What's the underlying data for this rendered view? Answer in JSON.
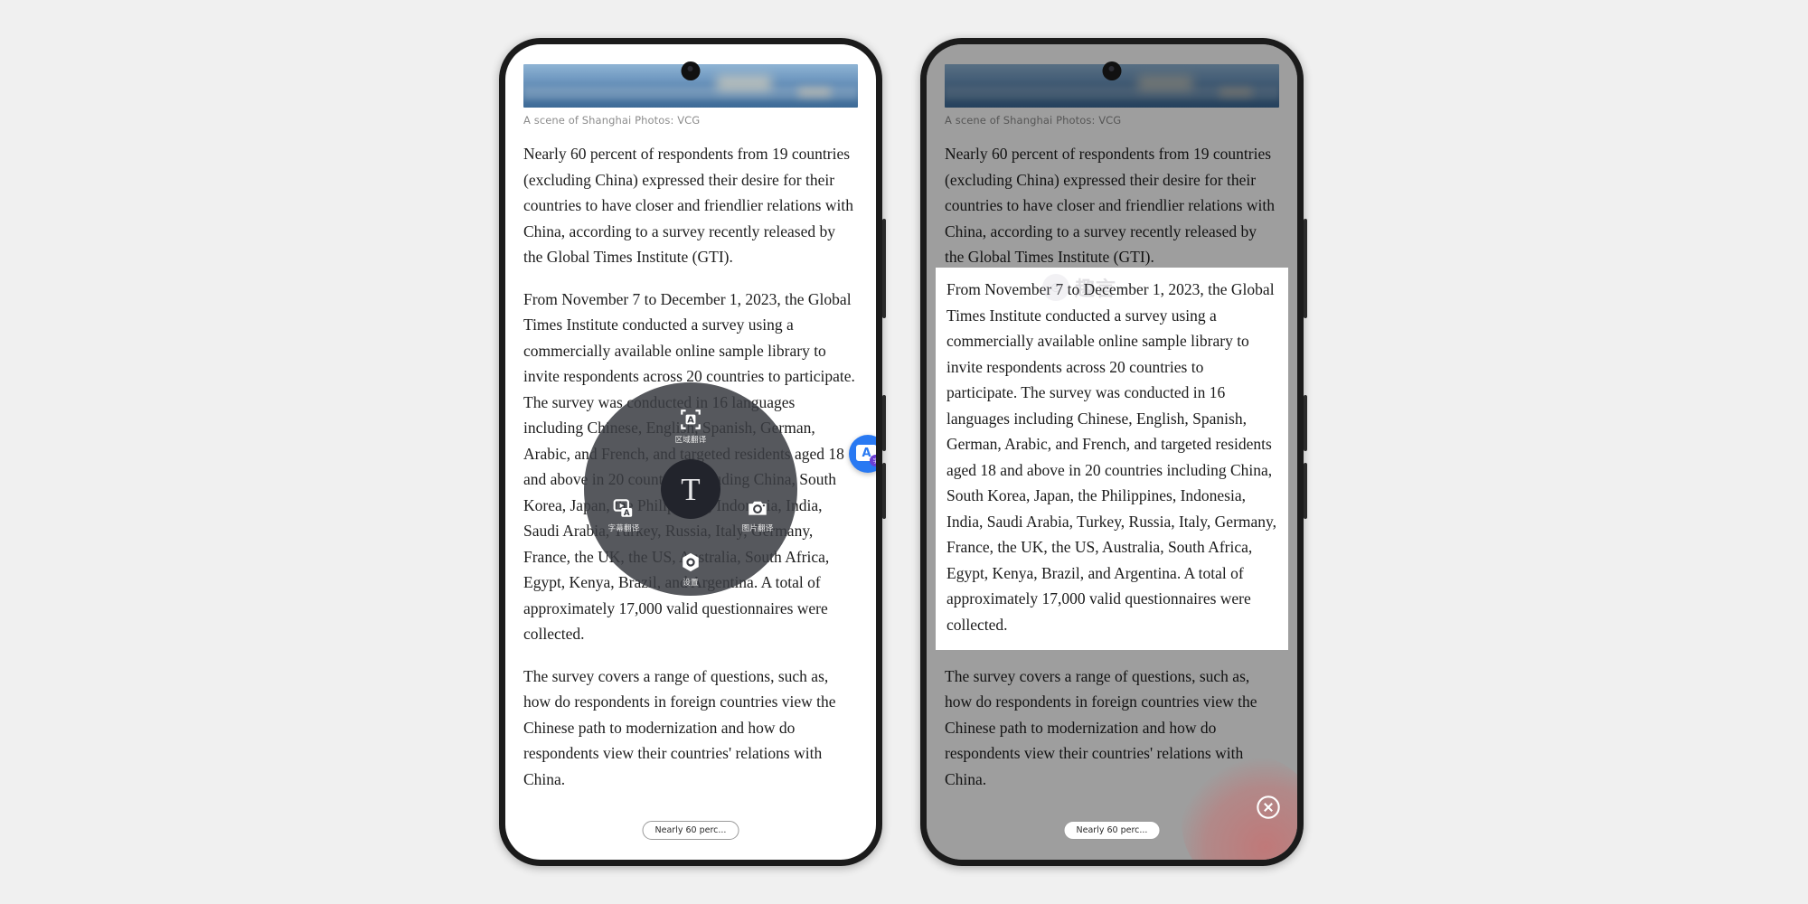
{
  "article": {
    "caption": "A scene of Shanghai Photos: VCG",
    "paragraphs": [
      "Nearly 60 percent of respondents from 19 countries (excluding China) expressed their desire for their countries to have closer and friendlier relations with China, according to a survey recently released by the Global Times Institute (GTI).",
      "From November 7 to December 1, 2023, the Global Times Institute conducted a survey using a commercially available online sample library to invite respondents across 20 countries to participate. The survey was conducted in 16 languages including Chinese, English, Spanish, German, Arabic, and French, and targeted residents aged 18 and above in 20 countries including China, South Korea, Japan, the Philippines, Indonesia, India, Saudi Arabia, Turkey, Russia, Italy, Germany, France, the UK, the US, Australia, South Africa, Egypt, Kenya, Brazil, and Argentina. A total of approximately 17,000 valid questionnaires were collected.",
      "The survey covers a range of questions, such as, how do respondents in foreign countries view the Chinese path to modernization and how do respondents view their countries' relations with China."
    ],
    "bottom_pill_label": "Nearly 60 perc..."
  },
  "radial_menu": {
    "center_glyph": "T",
    "center_name": "text-translate",
    "items": [
      {
        "label": "区域翻译",
        "icon": "area-translate-icon"
      },
      {
        "label": "字幕翻译",
        "icon": "subtitle-translate-icon"
      },
      {
        "label": "图片翻译",
        "icon": "image-translate-icon"
      },
      {
        "label": "设置",
        "icon": "settings-icon"
      }
    ]
  },
  "fab": {
    "letter": "A",
    "badge": "字",
    "color": "#2979F2",
    "badge_color": "#6C3FD4"
  },
  "watermark": {
    "mark": "⊜",
    "text": "趣言"
  },
  "colors": {
    "background": "#F0F0F0",
    "phone_frame": "#1B1B1B",
    "radial_bg": "rgba(58,60,66,0.86)",
    "dim": "rgba(0,0,0,0.38)",
    "close_glow": "#D66060"
  },
  "close_button": {
    "name": "close-overlay"
  }
}
